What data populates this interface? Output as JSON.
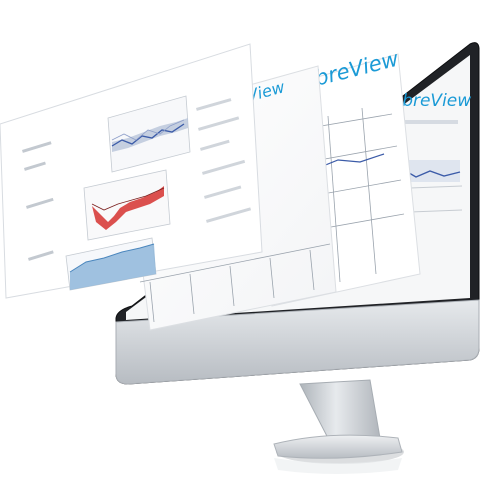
{
  "brand": {
    "logo_text": "LibreView",
    "logo_color": "#1a9ad6"
  },
  "colors": {
    "monitor_silver": "#cfd3d7",
    "monitor_bezel": "#1a1c1f",
    "sheet_background": "#ffffff",
    "trend_line": "#3b5ba8",
    "range_band": "#b8c4da",
    "low_glucose_red": "#d6322f",
    "area_fill": "#8fb7da",
    "status_yellow": "#e6d84a",
    "status_green": "#62b36b",
    "grid_line": "#9aa3ad"
  },
  "icons": [
    "monitor-icon",
    "libreview-logo",
    "yellow-status-dot-icon",
    "green-status-dot-icon"
  ]
}
